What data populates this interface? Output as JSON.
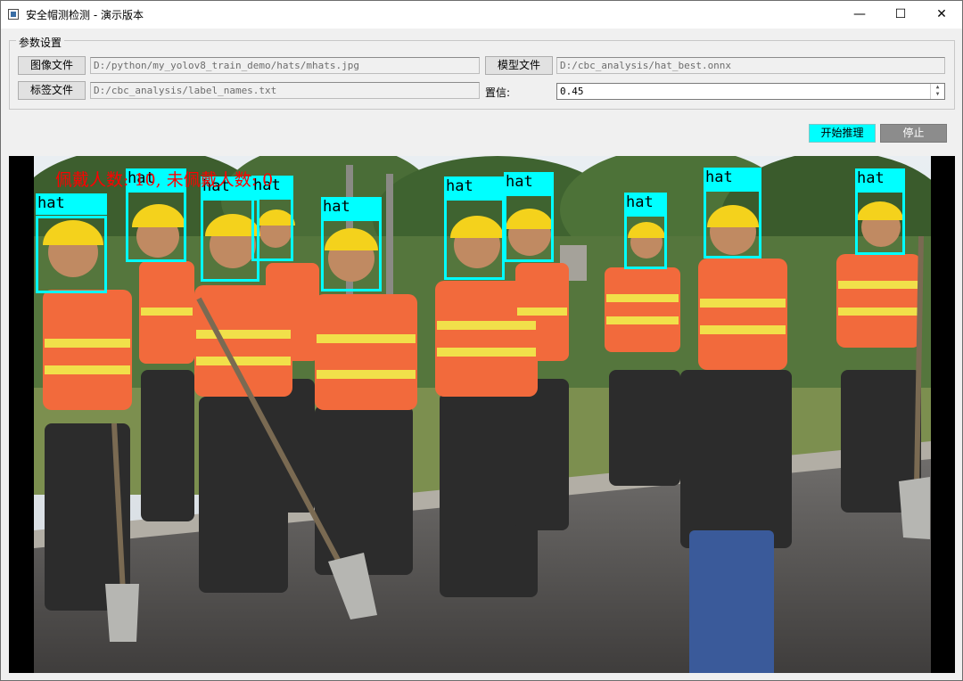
{
  "window": {
    "title": "安全帽测检测 - 演示版本",
    "controls": {
      "minimize": "—",
      "maximize": "☐",
      "close": "✕"
    }
  },
  "params": {
    "legend": "参数设置",
    "image_button": "图像文件",
    "image_path": "D:/python/my_yolov8_train_demo/hats/mhats.jpg",
    "model_button": "模型文件",
    "model_path": "D:/cbc_analysis/hat_best.onnx",
    "label_button": "标签文件",
    "label_path": "D:/cbc_analysis/label_names.txt",
    "confidence_label": "置信:",
    "confidence_value": "0.45"
  },
  "actions": {
    "start": "开始推理",
    "stop": "停止"
  },
  "result": {
    "overlay": "佩戴人数: 10,  未佩戴人数: 0",
    "worn_count": 10,
    "not_worn_count": 0,
    "detection_label": "hat",
    "detection_count": 10,
    "colors": {
      "box": "#00ffff",
      "overlay_text": "#ff0000"
    }
  }
}
